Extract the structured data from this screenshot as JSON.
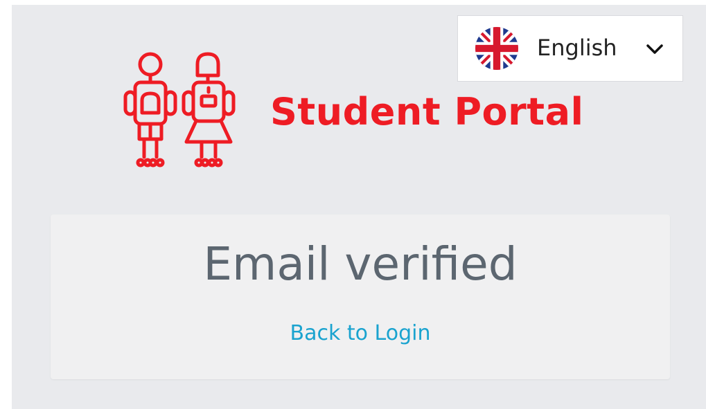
{
  "header": {
    "language": {
      "selected": "English",
      "flag_icon": "uk-flag-icon",
      "dropdown_icon": "chevron-down-icon"
    },
    "brand": {
      "name": "Student Portal",
      "color": "#ee1c24",
      "logo_icon": "student-figures-icon"
    }
  },
  "main": {
    "title": "Email verified",
    "back_link": "Back to Login",
    "link_color": "#1aa3cf"
  }
}
